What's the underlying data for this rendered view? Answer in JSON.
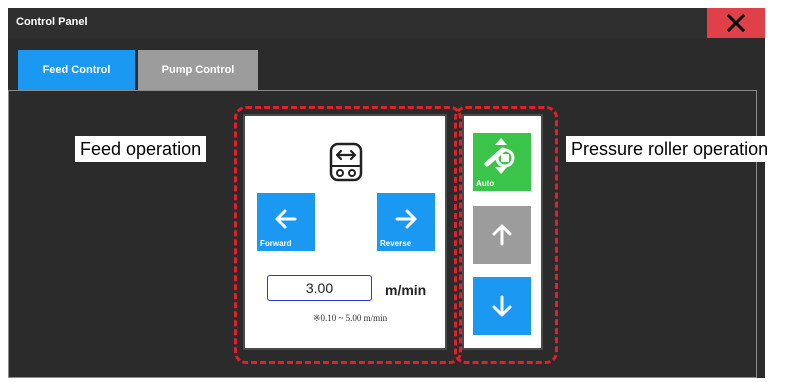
{
  "window": {
    "title": "Control Panel",
    "close_icon": "close-icon"
  },
  "tabs": [
    {
      "label": "Feed Control",
      "active": true
    },
    {
      "label": "Pump Control",
      "active": false
    }
  ],
  "feed_panel": {
    "icon": "feed-conveyor-icon",
    "forward_button": {
      "label": "Forward",
      "icon": "arrow-left-icon"
    },
    "reverse_button": {
      "label": "Reverse",
      "icon": "arrow-right-icon"
    },
    "speed_value": "3.00",
    "speed_unit": "m/min",
    "range_note": "※0.10 ~ 5.00 m/min"
  },
  "roller_panel": {
    "auto_button": {
      "label": "Auto",
      "icon": "pressure-roller-auto-icon"
    },
    "up_button": {
      "icon": "arrow-up-icon"
    },
    "down_button": {
      "icon": "arrow-down-icon"
    }
  },
  "callouts": {
    "feed": "Feed operation",
    "roller": "Pressure roller operation"
  },
  "colors": {
    "accent_blue": "#1a98f2",
    "auto_green": "#3bc44a",
    "disabled_gray": "#9c9c9c",
    "close_red": "#e0404a",
    "highlight_red": "#e0202a",
    "window_dark": "#2b2b2b"
  }
}
